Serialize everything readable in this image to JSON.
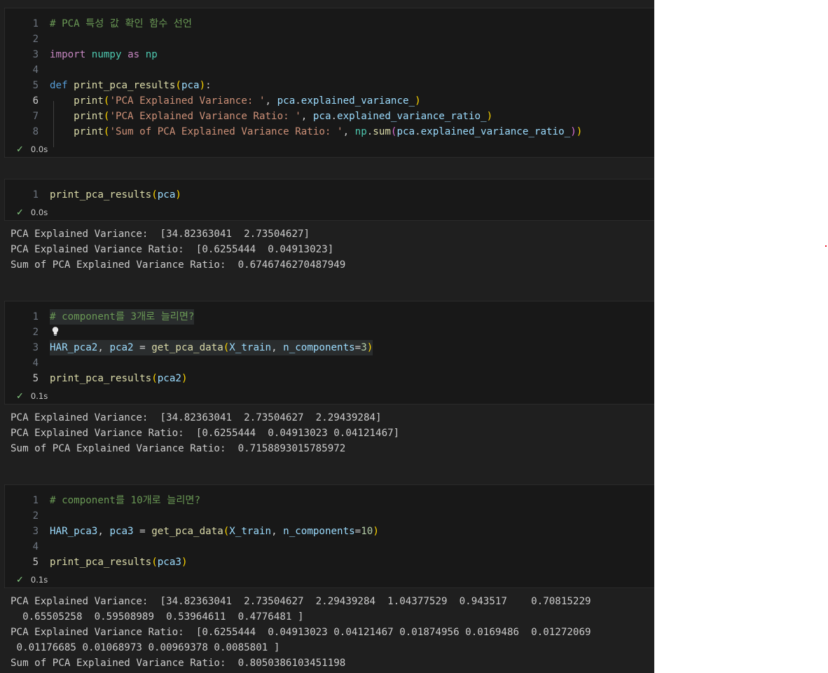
{
  "cells": [
    {
      "lines": [
        {
          "n": "1",
          "parts": [
            [
              "c-com",
              "# PCA 특성 값 확인 함수 선언"
            ]
          ]
        },
        {
          "n": "2",
          "parts": []
        },
        {
          "n": "3",
          "parts": [
            [
              "c-kw",
              "import"
            ],
            [
              "",
              "' '"
            ],
            [
              "c-mod",
              "numpy"
            ],
            [
              "",
              "' '"
            ],
            [
              "c-kw",
              "as"
            ],
            [
              "",
              "' '"
            ],
            [
              "c-mod",
              "np"
            ]
          ]
        },
        {
          "n": "4",
          "parts": []
        },
        {
          "n": "5",
          "parts": [
            [
              "c-def",
              "def"
            ],
            [
              "",
              "' '"
            ],
            [
              "c-fn",
              "print_pca_results"
            ],
            [
              "c-p1",
              "("
            ],
            [
              "c-var",
              "pca"
            ],
            [
              "c-p1",
              ")"
            ],
            [
              "",
              ":"
            ]
          ]
        },
        {
          "n": "6",
          "active": true,
          "parts": [
            [
              "",
              "    "
            ],
            [
              "c-fn",
              "print"
            ],
            [
              "c-p1",
              "("
            ],
            [
              "c-str",
              "'PCA Explained Variance: '"
            ],
            [
              "",
              ", "
            ],
            [
              "c-var",
              "pca"
            ],
            [
              "",
              "."
            ],
            [
              "c-var",
              "explained_variance_"
            ],
            [
              "c-p1",
              ")"
            ]
          ]
        },
        {
          "n": "7",
          "parts": [
            [
              "",
              "    "
            ],
            [
              "c-fn",
              "print"
            ],
            [
              "c-p1",
              "("
            ],
            [
              "c-str",
              "'PCA Explained Variance Ratio: '"
            ],
            [
              "",
              ", "
            ],
            [
              "c-var",
              "pca"
            ],
            [
              "",
              "."
            ],
            [
              "c-var",
              "explained_variance_ratio_"
            ],
            [
              "c-p1",
              ")"
            ]
          ]
        },
        {
          "n": "8",
          "parts": [
            [
              "",
              "    "
            ],
            [
              "c-fn",
              "print"
            ],
            [
              "c-p1",
              "("
            ],
            [
              "c-str",
              "'Sum of PCA Explained Variance Ratio: '"
            ],
            [
              "",
              ", "
            ],
            [
              "c-mod",
              "np"
            ],
            [
              "",
              "."
            ],
            [
              "c-fn",
              "sum"
            ],
            [
              "c-p2",
              "("
            ],
            [
              "c-var",
              "pca"
            ],
            [
              "",
              "."
            ],
            [
              "c-var",
              "explained_variance_ratio_"
            ],
            [
              "c-p2",
              ")"
            ],
            [
              "c-p1",
              ")"
            ]
          ]
        }
      ],
      "status": "0.0s"
    },
    {
      "lines": [
        {
          "n": "1",
          "parts": [
            [
              "c-fn",
              "print_pca_results"
            ],
            [
              "c-p1",
              "("
            ],
            [
              "c-var",
              "pca"
            ],
            [
              "c-p1",
              ")"
            ]
          ]
        }
      ],
      "status": "0.0s",
      "output": "PCA Explained Variance:  [34.82363041  2.73504627]\nPCA Explained Variance Ratio:  [0.6255444  0.04913023]\nSum of PCA Explained Variance Ratio:  0.6746746270487949"
    },
    {
      "lines": [
        {
          "n": "1",
          "hl": true,
          "parts": [
            [
              "c-com",
              "# component를 3개로 늘리면?"
            ]
          ]
        },
        {
          "n": "2",
          "bulb": true,
          "parts": []
        },
        {
          "n": "3",
          "hl": true,
          "parts": [
            [
              "c-var",
              "HAR_pca2"
            ],
            [
              "",
              ", "
            ],
            [
              "c-var",
              "pca2"
            ],
            [
              "",
              " = "
            ],
            [
              "c-fn",
              "get_pca_data"
            ],
            [
              "c-p1",
              "("
            ],
            [
              "c-var",
              "X_train"
            ],
            [
              "",
              ", "
            ],
            [
              "c-var",
              "n_components"
            ],
            [
              "",
              "="
            ],
            [
              "c-num",
              "3"
            ],
            [
              "c-p1",
              ")"
            ]
          ]
        },
        {
          "n": "4",
          "parts": []
        },
        {
          "n": "5",
          "active": true,
          "parts": [
            [
              "c-fn",
              "print_pca_results"
            ],
            [
              "c-p1",
              "("
            ],
            [
              "c-var",
              "pca2"
            ],
            [
              "c-p1",
              ")"
            ]
          ]
        }
      ],
      "status": "0.1s",
      "output": "PCA Explained Variance:  [34.82363041  2.73504627  2.29439284]\nPCA Explained Variance Ratio:  [0.6255444  0.04913023 0.04121467]\nSum of PCA Explained Variance Ratio:  0.7158893015785972"
    },
    {
      "lines": [
        {
          "n": "1",
          "parts": [
            [
              "c-com",
              "# component를 10개로 늘리면?"
            ]
          ]
        },
        {
          "n": "2",
          "parts": []
        },
        {
          "n": "3",
          "parts": [
            [
              "c-var",
              "HAR_pca3"
            ],
            [
              "",
              ", "
            ],
            [
              "c-var",
              "pca3"
            ],
            [
              "",
              " = "
            ],
            [
              "c-fn",
              "get_pca_data"
            ],
            [
              "c-p1",
              "("
            ],
            [
              "c-var",
              "X_train"
            ],
            [
              "",
              ", "
            ],
            [
              "c-var",
              "n_components"
            ],
            [
              "",
              "="
            ],
            [
              "c-num",
              "10"
            ],
            [
              "c-p1",
              ")"
            ]
          ]
        },
        {
          "n": "4",
          "parts": []
        },
        {
          "n": "5",
          "active": true,
          "parts": [
            [
              "c-fn",
              "print_pca_results"
            ],
            [
              "c-p1",
              "("
            ],
            [
              "c-var",
              "pca3"
            ],
            [
              "c-p1",
              ")"
            ]
          ]
        }
      ],
      "status": "0.1s",
      "output": "PCA Explained Variance:  [34.82363041  2.73504627  2.29439284  1.04377529  0.943517    0.70815229\n  0.65505258  0.59508989  0.53964611  0.4776481 ]\nPCA Explained Variance Ratio:  [0.6255444  0.04913023 0.04121467 0.01874956 0.0169486  0.01272069\n 0.01176685 0.01068973 0.00969378 0.0085801 ]\nSum of PCA Explained Variance Ratio:  0.8050386103451198"
    }
  ],
  "icons": {
    "status": "check-icon",
    "hint": "lightbulb-icon"
  },
  "colors": {
    "editor_bg": "#181818",
    "notebook_bg": "#1f1f1f",
    "comment": "#6a9955",
    "keyword": "#c586c0",
    "function": "#dcdcaa",
    "string": "#ce9178",
    "variable": "#9cdcfe",
    "success": "#89d185"
  }
}
